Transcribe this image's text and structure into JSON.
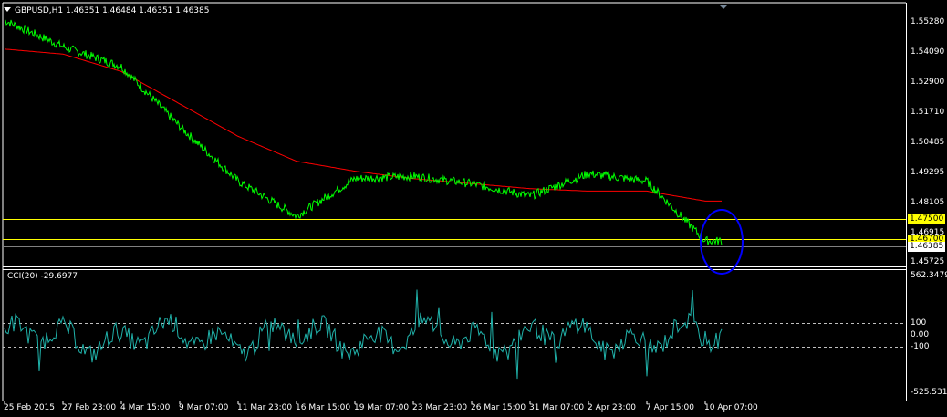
{
  "symbol_header": "GBPUSD,H1  1.46351 1.46484 1.46351 1.46385",
  "cci_header": "CCI(20) -29.6977",
  "price_axis": [
    "1.55280",
    "1.54090",
    "1.52900",
    "1.51710",
    "1.50485",
    "1.49295",
    "1.48105",
    "1.46915",
    "1.45725"
  ],
  "hline_labels": [
    "1.47500",
    "1.46700"
  ],
  "current_price": "1.46385",
  "cci_axis": [
    "562.3479",
    "100",
    "0.00",
    "-100",
    "-525.5311"
  ],
  "time_axis": [
    "25 Feb 2015",
    "27 Feb 23:00",
    "4 Mar 15:00",
    "9 Mar 07:00",
    "11 Mar 23:00",
    "16 Mar 15:00",
    "19 Mar 07:00",
    "23 Mar 23:00",
    "26 Mar 15:00",
    "31 Mar 07:00",
    "2 Apr 23:00",
    "7 Apr 15:00",
    "10 Apr 07:00"
  ],
  "colors": {
    "price": "#00ff00",
    "ma": "#ff0000",
    "hlines": "#ffff00",
    "cci": "#20b2aa",
    "ellipse": "#0000ff",
    "axis": "#ffffff"
  },
  "chart_data": {
    "type": "line",
    "x": [
      "25 Feb 2015",
      "27 Feb 23:00",
      "4 Mar 15:00",
      "9 Mar 07:00",
      "11 Mar 23:00",
      "16 Mar 15:00",
      "19 Mar 07:00",
      "23 Mar 23:00",
      "26 Mar 15:00",
      "31 Mar 07:00",
      "2 Apr 23:00",
      "7 Apr 15:00",
      "10 Apr 07:00"
    ],
    "ylim": [
      1.4545,
      1.5585
    ],
    "series": [
      {
        "name": "GBPUSD",
        "values": [
          1.5525,
          1.542,
          1.534,
          1.51,
          1.488,
          1.474,
          1.489,
          1.49,
          1.487,
          1.482,
          1.491,
          1.488,
          1.464
        ]
      },
      {
        "name": "",
        "values": [
          1.541,
          1.539,
          1.532,
          1.519,
          1.506,
          1.496,
          1.492,
          1.489,
          1.487,
          1.485,
          1.484,
          1.484,
          1.48
        ]
      }
    ],
    "hlines": [
      1.475,
      1.467
    ],
    "indicator": {
      "name": "CCI(20)",
      "ylim": [
        -525.5311,
        562.3479
      ],
      "levels": [
        100,
        0,
        -100
      ]
    }
  }
}
